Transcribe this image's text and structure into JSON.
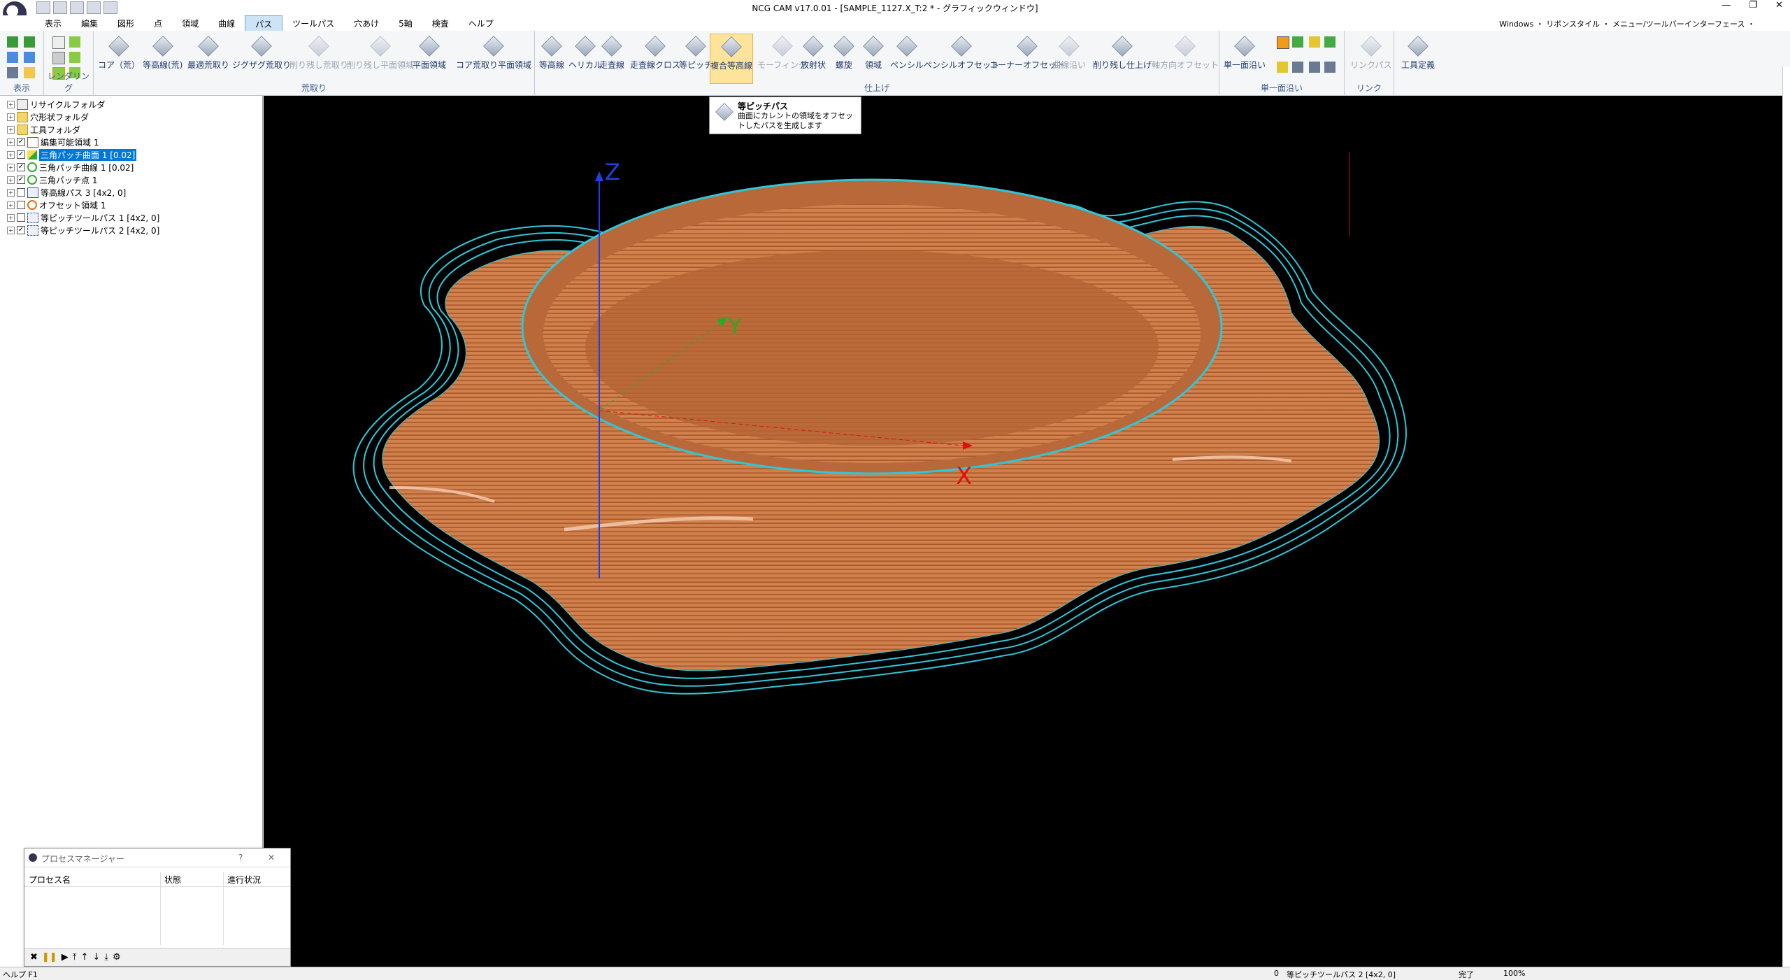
{
  "window": {
    "title": "NCG CAM v17.0.01 - [SAMPLE_1127.X_T:2 * - グラフィックウィンドウ]",
    "controls": [
      "—",
      "❐",
      "✕"
    ]
  },
  "menu": {
    "items": [
      "表示",
      "編集",
      "図形",
      "点",
      "領域",
      "曲線",
      "パス",
      "ツールパス",
      "穴あけ",
      "5軸",
      "検査",
      "ヘルプ"
    ],
    "active_index": 6,
    "right": "Windows ・ リボンスタイル ・ メニュー/ツールバーインターフェース ・"
  },
  "ribbon": {
    "groups": {
      "display": "表示",
      "rendering": "レンダリング",
      "roughing": "荒取り",
      "finishing": "仕上げ",
      "single_surface": "単一面沿い",
      "link": "リンク"
    },
    "roughing_buttons": [
      "コア（荒）",
      "等高線(荒)",
      "最適荒取り",
      "ジグザグ荒取り",
      "削り残し荒取り",
      "削り残し平面領域",
      "平面領域",
      "コア荒取り平面領域"
    ],
    "finishing_buttons": [
      "等高線",
      "ヘリカル",
      "走査線",
      "走査線クロス",
      "等ピッチ",
      "複合等高線",
      "モーフィング",
      "放射状",
      "螺旋",
      "領域",
      "ペンシル",
      "ペンシルオフセット",
      "コーナーオフセット",
      "曲線沿い",
      "削り残し仕上げ",
      "軸方向オフセット"
    ],
    "single_surface_button": "単一面沿い",
    "link_button": "リンクパス",
    "tool_button": "工具定義"
  },
  "tooltip": {
    "title": "等ピッチパス",
    "description": "曲面にカレントの領域をオフセットしたパスを生成します"
  },
  "tree": {
    "items": [
      {
        "label": "リサイクルフォルダ",
        "checkbox": false,
        "checked": false,
        "selected": false,
        "icon": "recycle-icon"
      },
      {
        "label": "穴形状フォルダ",
        "checkbox": false,
        "checked": false,
        "selected": false,
        "icon": "folder-icon"
      },
      {
        "label": "工具フォルダ",
        "checkbox": false,
        "checked": false,
        "selected": false,
        "icon": "folder-icon"
      },
      {
        "label": "編集可能領域 1",
        "checkbox": true,
        "checked": true,
        "selected": false,
        "icon": "region-icon"
      },
      {
        "label": "三角パッチ曲面 1 [0.02]",
        "checkbox": true,
        "checked": true,
        "selected": true,
        "icon": "triangle-surface-icon"
      },
      {
        "label": "三角パッチ曲線 1 [0.02]",
        "checkbox": true,
        "checked": true,
        "selected": false,
        "icon": "triangle-curve-icon"
      },
      {
        "label": "三角パッチ点 1",
        "checkbox": true,
        "checked": true,
        "selected": false,
        "icon": "triangle-point-icon"
      },
      {
        "label": "等高線パス 3 [4x2, 0]",
        "checkbox": true,
        "checked": false,
        "selected": false,
        "icon": "toolpath-icon"
      },
      {
        "label": "オフセット領域 1",
        "checkbox": true,
        "checked": false,
        "selected": false,
        "icon": "offset-region-icon"
      },
      {
        "label": "等ピッチツールパス 1 [4x2, 0]",
        "checkbox": true,
        "checked": false,
        "selected": false,
        "icon": "toolpath-icon"
      },
      {
        "label": "等ピッチツールパス 2 [4x2, 0]",
        "checkbox": true,
        "checked": true,
        "selected": false,
        "icon": "toolpath-icon"
      }
    ]
  },
  "viewport": {
    "axes": {
      "z": "Z",
      "y": "Y",
      "x": "X"
    },
    "colors": {
      "background": "#000000",
      "part": "#c8733f",
      "toolpath": "#2fc6d8",
      "z_axis": "#2040e0",
      "y_axis": "#20b020",
      "x_axis": "#e01010"
    }
  },
  "process_manager": {
    "title": "プロセスマネージャー",
    "help": "?",
    "close": "✕",
    "columns": [
      "プロセス名",
      "状態",
      "進行状況"
    ]
  },
  "status": {
    "help": "ヘルプ F1",
    "count": "0",
    "current": "等ピッチツールパス 2 [4x2, 0]",
    "state": "完了",
    "zoom": "100%"
  }
}
